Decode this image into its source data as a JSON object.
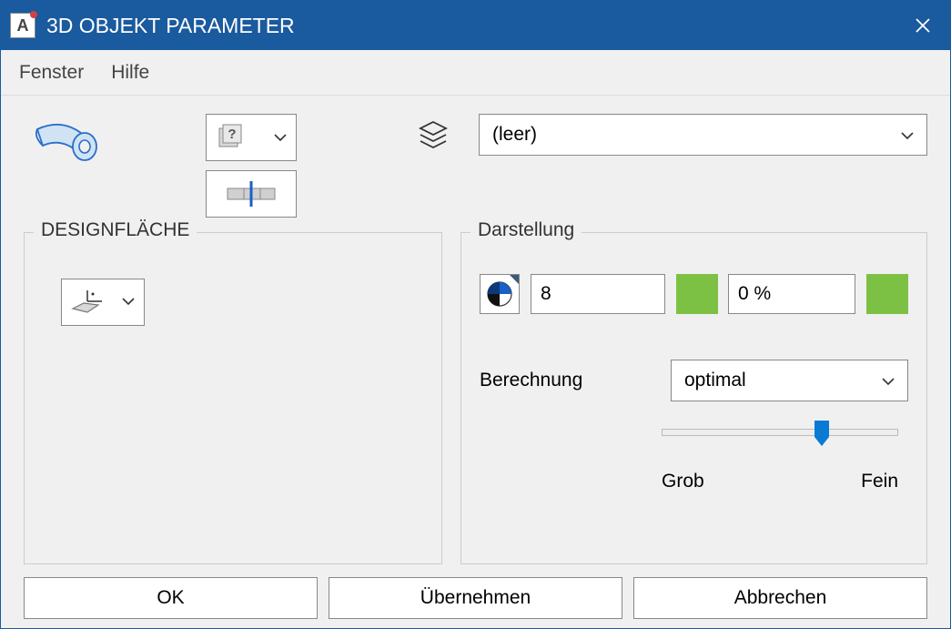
{
  "window": {
    "title": "3D OBJEKT PARAMETER",
    "app_icon_letter": "A"
  },
  "menu": {
    "items": [
      "Fenster",
      "Hilfe"
    ]
  },
  "top": {
    "object_type_icon": "bent-tube-icon",
    "help_icon_glyph": "?",
    "layer_select_value": "(leer)"
  },
  "panels": {
    "design": {
      "title": "DESIGNFLÄCHE"
    },
    "display": {
      "title": "Darstellung",
      "pen_value": "8",
      "fill_percent": "0 %",
      "calc_label": "Berechnung",
      "calc_value": "optimal",
      "slider_left": "Grob",
      "slider_right": "Fein",
      "color_swatch1": "#7cc144",
      "color_swatch2": "#7cc144"
    }
  },
  "buttons": {
    "ok": "OK",
    "apply": "Übernehmen",
    "cancel": "Abbrechen"
  }
}
